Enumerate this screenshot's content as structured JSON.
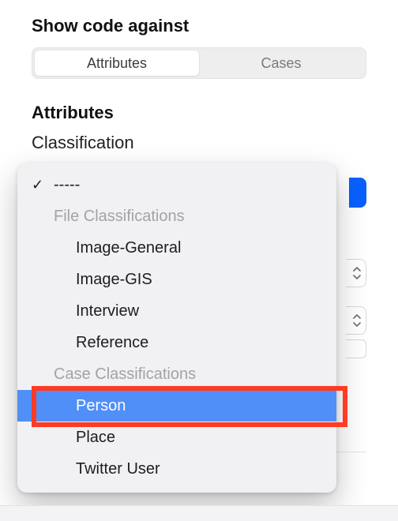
{
  "section_title": "Show code against",
  "segmented": {
    "attributes": "Attributes",
    "cases": "Cases"
  },
  "attributes_title": "Attributes",
  "classification_label": "Classification",
  "dropdown": {
    "selected_checkmark": "✓",
    "none_label": "-----",
    "group1_header": "File Classifications",
    "group1_items": [
      "Image-General",
      "Image-GIS",
      "Interview",
      "Reference"
    ],
    "group2_header": "Case Classifications",
    "group2_items": [
      "Person",
      "Place",
      "Twitter User"
    ],
    "highlighted_index": 0
  }
}
